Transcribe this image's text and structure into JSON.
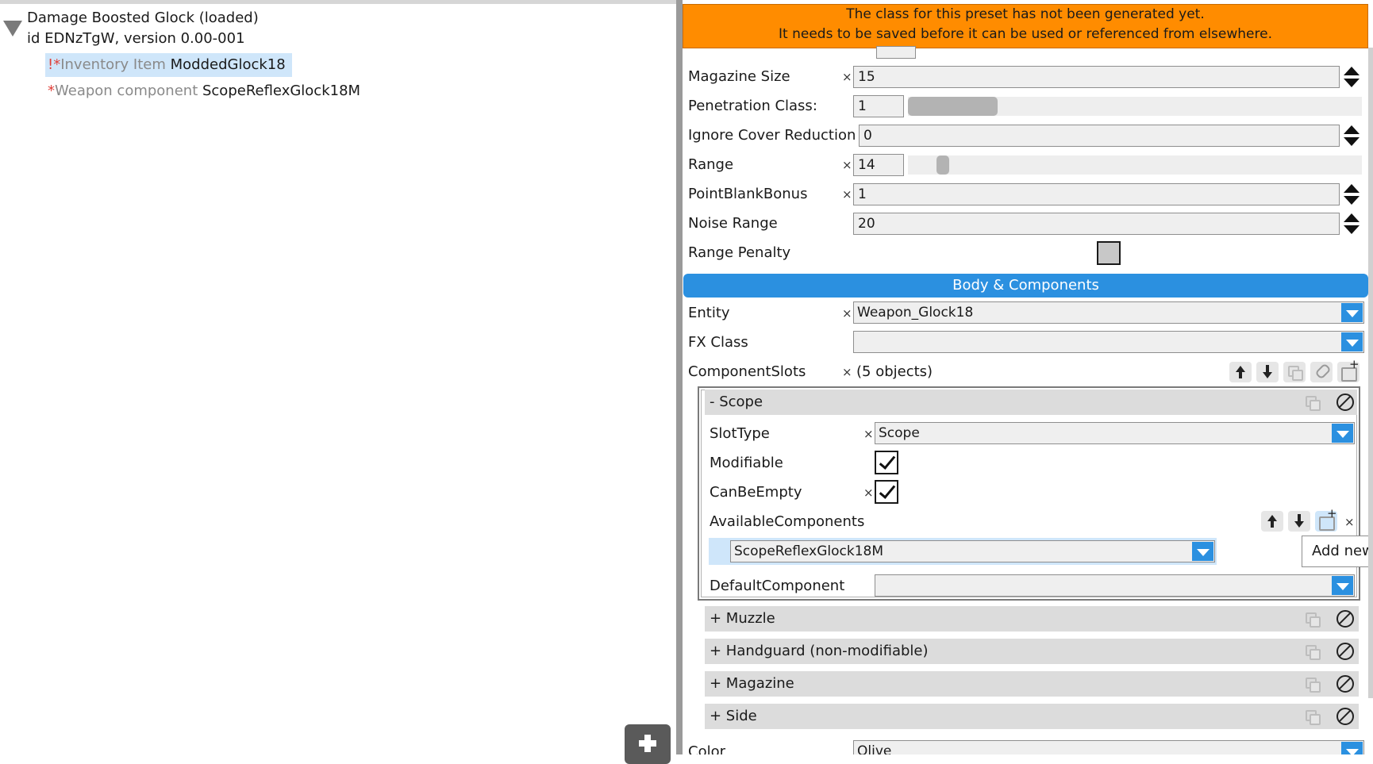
{
  "tree": {
    "root_title": "Damage Boosted Glock (loaded)",
    "root_id": "id EDNzTgW, version 0.00-001",
    "items": [
      {
        "mark": "!*",
        "kind": "Inventory Item",
        "name": "ModdedGlock18",
        "selected": true
      },
      {
        "mark": "*",
        "kind": "Weapon component",
        "name": "ScopeReflexGlock18M",
        "selected": false
      }
    ]
  },
  "banner": {
    "line1": "The class for this preset has not been generated yet.",
    "line2": "It needs to be saved before it can be used or referenced from elsewhere."
  },
  "fields": {
    "magazine_size": {
      "label": "Magazine Size",
      "value": "15"
    },
    "penetration_class": {
      "label": "Penetration Class:",
      "value": "1"
    },
    "ignore_cover_reduction": {
      "label": "Ignore Cover Reduction",
      "value": "0"
    },
    "range": {
      "label": "Range",
      "value": "14"
    },
    "point_blank_bonus": {
      "label": "PointBlankBonus",
      "value": "1"
    },
    "noise_range": {
      "label": "Noise Range",
      "value": "20"
    },
    "range_penalty": {
      "label": "Range Penalty",
      "checked": false
    }
  },
  "section_title": "Body & Components",
  "entity": {
    "label": "Entity",
    "value": "Weapon_Glock18"
  },
  "fx_class": {
    "label": "FX Class",
    "value": ""
  },
  "component_slots": {
    "label": "ComponentSlots",
    "count": "(5 objects)"
  },
  "scope_slot": {
    "header": "- Scope",
    "slot_type": {
      "label": "SlotType",
      "value": "Scope"
    },
    "modifiable": {
      "label": "Modifiable",
      "checked": true
    },
    "can_be_empty": {
      "label": "CanBeEmpty",
      "checked": true
    },
    "available_components": {
      "label": "AvailableComponents",
      "value": "ScopeReflexGlock18M"
    },
    "default_component": {
      "label": "DefaultComponent",
      "value": ""
    }
  },
  "collapsed_slots": [
    "+ Muzzle",
    "+ Handguard (non-modifiable)",
    "+ Magazine",
    "+ Side"
  ],
  "color": {
    "label": "Color",
    "value": "Olive"
  },
  "tooltip": "Add new",
  "remove_symbol": "×"
}
